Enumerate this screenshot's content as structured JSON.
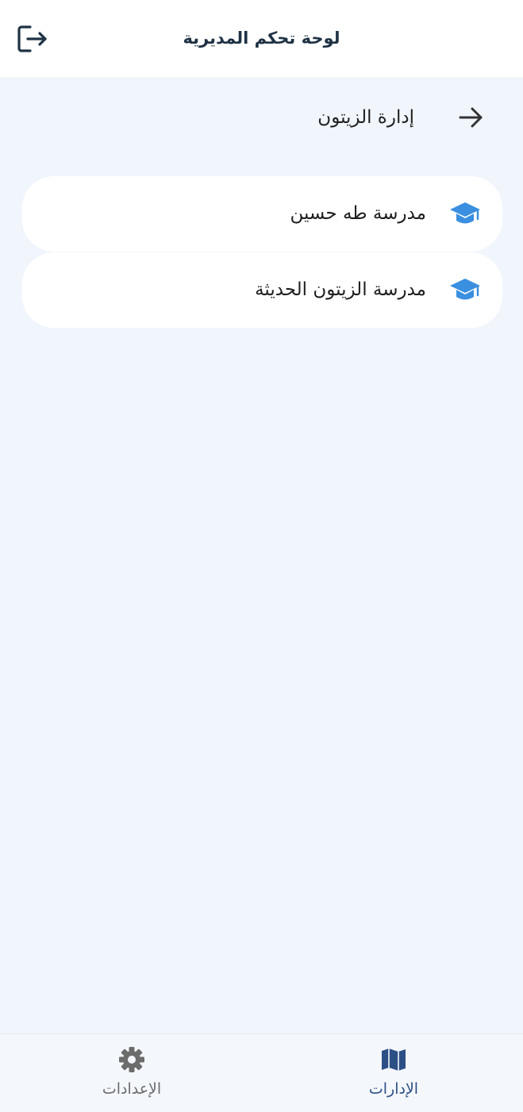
{
  "app_bar": {
    "title": "لوحة تحكم المديرية",
    "logout_icon": "logout-icon"
  },
  "section": {
    "title": "إدارة الزيتون",
    "back_icon": "arrow-right-icon"
  },
  "schools": [
    {
      "name": "مدرسة طه حسين",
      "icon": "graduation-cap-icon"
    },
    {
      "name": "مدرسة الزيتون الحديثة",
      "icon": "graduation-cap-icon"
    }
  ],
  "bottom_nav": {
    "items": [
      {
        "label": "الإدارات",
        "icon": "map-icon",
        "active": true
      },
      {
        "label": "الإعدادات",
        "icon": "gear-icon",
        "active": false
      }
    ]
  },
  "colors": {
    "background": "#f1f6fd",
    "accent_blue": "#3a8fe0",
    "nav_active": "#2c4f86",
    "title_text": "#1f3244"
  }
}
